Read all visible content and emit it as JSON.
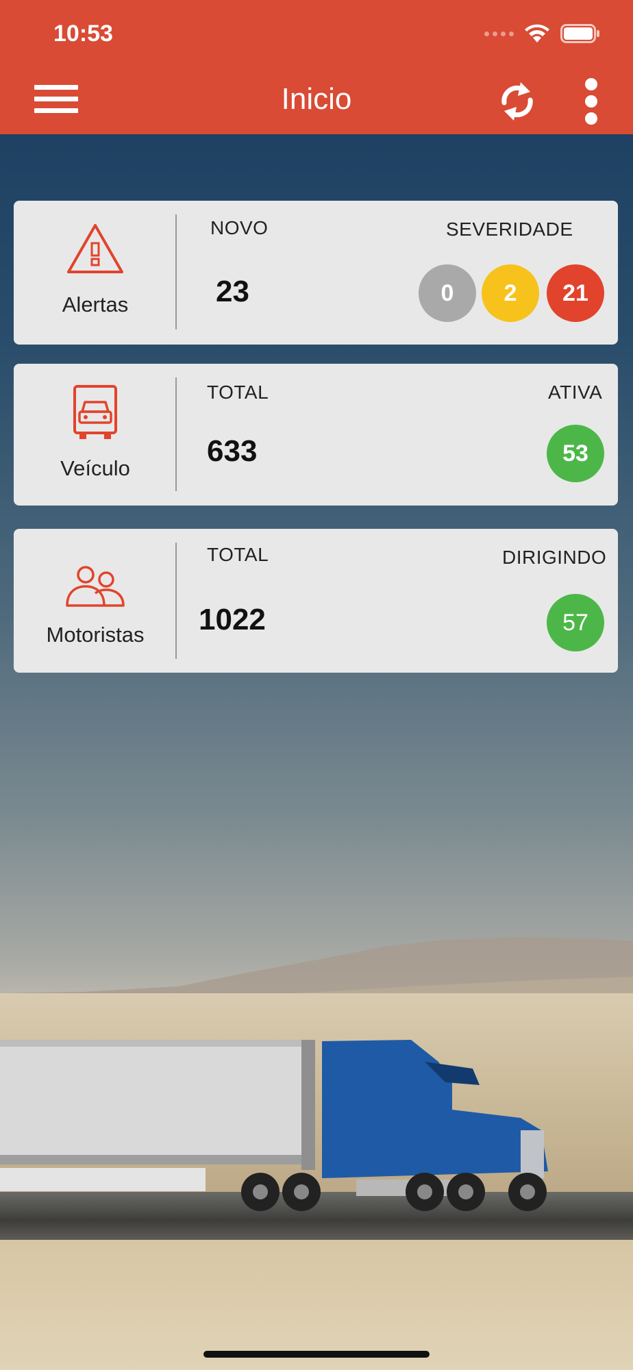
{
  "status_bar": {
    "time": "10:53"
  },
  "nav": {
    "title": "Inicio"
  },
  "cards": {
    "alerts": {
      "label": "Alertas",
      "new_label": "NOVO",
      "new_value": "23",
      "severity_label": "SEVERIDADE",
      "severity_values": [
        "0",
        "2",
        "21"
      ]
    },
    "vehicles": {
      "label": "Veículo",
      "total_label": "TOTAL",
      "total_value": "633",
      "active_label": "ATIVA",
      "active_value": "53"
    },
    "drivers": {
      "label": "Motoristas",
      "total_label": "TOTAL",
      "total_value": "1022",
      "driving_label": "DIRIGINDO",
      "driving_value": "57"
    }
  },
  "icons": {
    "menu": "hamburger-menu-icon",
    "refresh": "refresh-icon",
    "more": "more-vertical-icon",
    "alert": "warning-triangle-icon",
    "vehicle": "truck-front-icon",
    "drivers": "users-icon"
  },
  "colors": {
    "accent": "#d94b35",
    "severity_low": "#a9a9a9",
    "severity_medium": "#f7c21c",
    "severity_high": "#e2432c",
    "active_green": "#4cb748",
    "card_bg": "#e8e8e8"
  }
}
